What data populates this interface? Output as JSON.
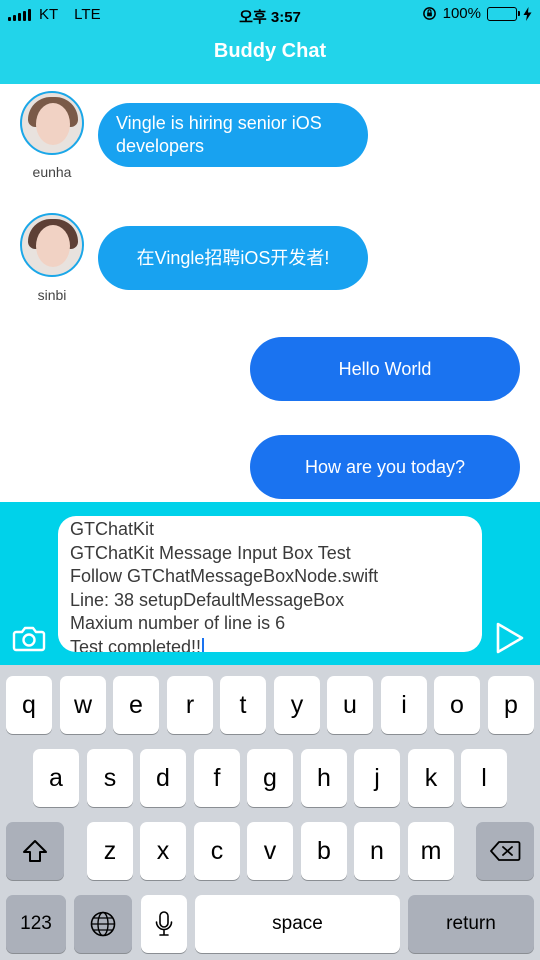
{
  "status_bar": {
    "carrier": "KT",
    "network": "LTE",
    "time": "오후 3:57",
    "battery_percent": "100%",
    "battery_level": 1.0
  },
  "header": {
    "title": "Buddy Chat"
  },
  "messages": [
    {
      "sender": "eunha",
      "direction": "incoming",
      "text": "Vingle is hiring senior iOS developers"
    },
    {
      "sender": "sinbi",
      "direction": "incoming",
      "text": "在Vingle招聘iOS开发者!"
    },
    {
      "direction": "outgoing",
      "text": "Hello World"
    },
    {
      "direction": "outgoing",
      "text": "How are you today?"
    }
  ],
  "input": {
    "lines": [
      "GTChatKit",
      "GTChatKit Message Input Box Test",
      "Follow GTChatMessageBoxNode.swift",
      "Line: 38 setupDefaultMessageBox",
      "Maxium number of line is 6",
      "Test completed!!"
    ],
    "left_icon": "camera-icon",
    "right_icon": "send-icon"
  },
  "keyboard": {
    "row1": [
      "q",
      "w",
      "e",
      "r",
      "t",
      "y",
      "u",
      "i",
      "o",
      "p"
    ],
    "row2": [
      "a",
      "s",
      "d",
      "f",
      "g",
      "h",
      "j",
      "k",
      "l"
    ],
    "row3": [
      "z",
      "x",
      "c",
      "v",
      "b",
      "n",
      "m"
    ],
    "numbers_label": "123",
    "space_label": "space",
    "return_label": "return",
    "shift_icon": "shift-icon",
    "delete_icon": "backspace-icon",
    "globe_icon": "globe-icon",
    "mic_icon": "microphone-icon"
  },
  "colors": {
    "header": "#22d4ea",
    "incoming_bubble": "#18a2f0",
    "outgoing_bubble": "#1a73f0",
    "input_bar": "#00d2ea"
  }
}
